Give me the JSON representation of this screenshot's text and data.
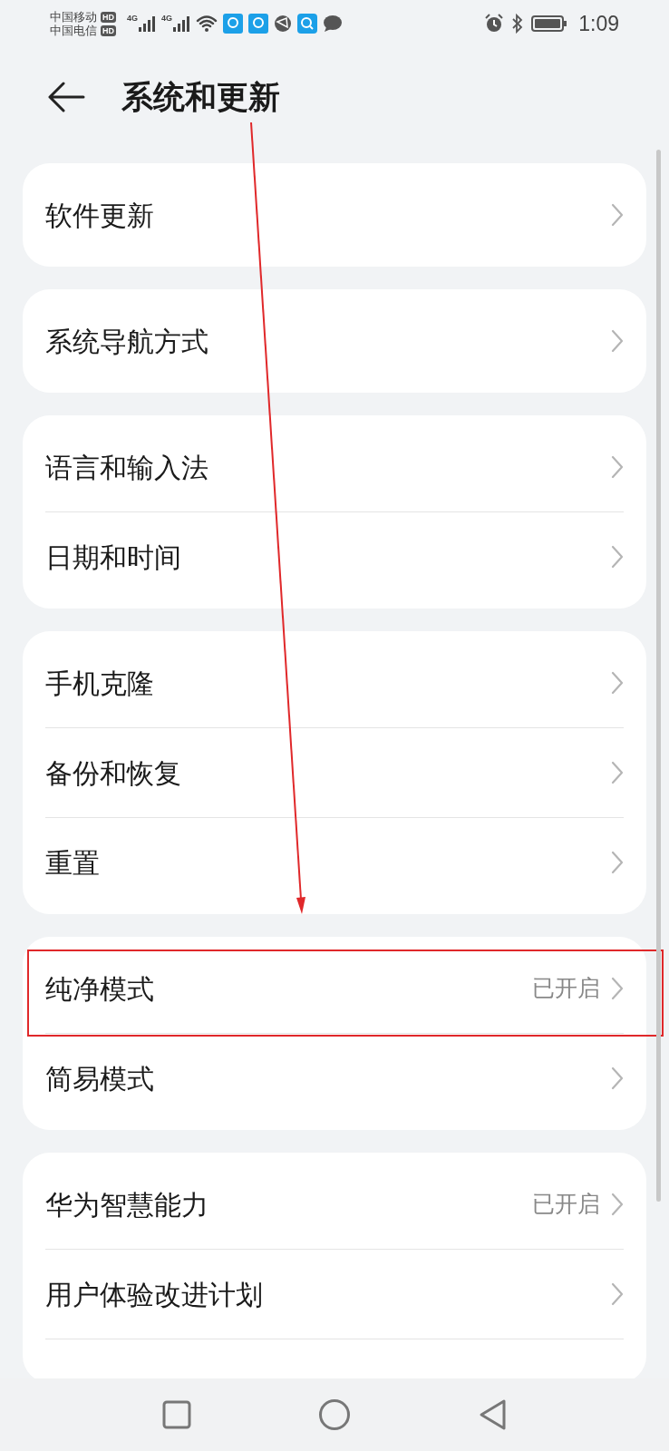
{
  "status_bar": {
    "carriers": [
      {
        "name": "中国移动",
        "badge": "HD"
      },
      {
        "name": "中国电信",
        "badge": "HD"
      }
    ],
    "networks": [
      "4G",
      "4G"
    ],
    "time": "1:09"
  },
  "header": {
    "title": "系统和更新"
  },
  "sections": [
    {
      "items": [
        {
          "label": "软件更新"
        }
      ]
    },
    {
      "items": [
        {
          "label": "系统导航方式"
        }
      ]
    },
    {
      "items": [
        {
          "label": "语言和输入法"
        },
        {
          "label": "日期和时间"
        }
      ]
    },
    {
      "items": [
        {
          "label": "手机克隆"
        },
        {
          "label": "备份和恢复"
        },
        {
          "label": "重置"
        }
      ]
    },
    {
      "items": [
        {
          "label": "纯净模式",
          "value": "已开启",
          "highlighted": true
        },
        {
          "label": "简易模式"
        }
      ]
    },
    {
      "items": [
        {
          "label": "华为智慧能力",
          "value": "已开启"
        },
        {
          "label": "用户体验改进计划"
        },
        {
          "kind": "cut"
        }
      ]
    }
  ]
}
